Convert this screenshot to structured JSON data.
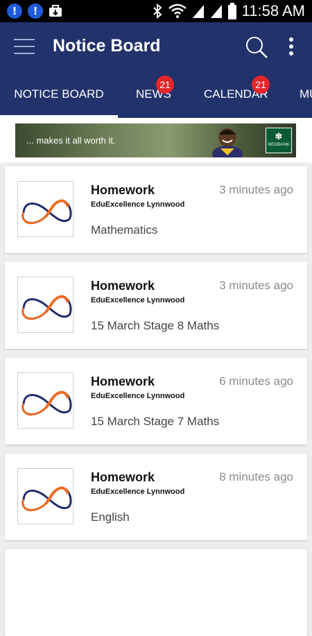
{
  "status_bar": {
    "time": "11:58 AM",
    "left_icons": [
      "alert-icon",
      "alert-icon",
      "briefcase-download-icon"
    ],
    "right_icons": [
      "bluetooth-icon",
      "wifi-icon",
      "signal-icon",
      "signal-icon",
      "battery-icon"
    ]
  },
  "app_bar": {
    "title": "Notice Board"
  },
  "tabs": [
    {
      "label": "NOTICE BOARD",
      "badge": ""
    },
    {
      "label": "NEWS",
      "badge": "21"
    },
    {
      "label": "CALENDAR",
      "badge": "21"
    },
    {
      "label": "MU",
      "badge": ""
    }
  ],
  "banner": {
    "text": "... makes it all worth it.",
    "brand": "NEDBANK"
  },
  "colors": {
    "app_bar": "#22326b",
    "badge": "#e5262a",
    "logo_navy": "#1f2d6b",
    "logo_orange": "#f06a21"
  },
  "notices": [
    {
      "title": "Homework",
      "school": "EduExcellence Lynnwood",
      "time": "3 minutes ago",
      "body": "Mathematics"
    },
    {
      "title": "Homework",
      "school": "EduExcellence Lynnwood",
      "time": "3 minutes ago",
      "body": "15 March Stage 8 Maths"
    },
    {
      "title": "Homework",
      "school": "EduExcellence Lynnwood",
      "time": "6 minutes ago",
      "body": "15 March Stage 7 Maths"
    },
    {
      "title": "Homework",
      "school": "EduExcellence Lynnwood",
      "time": "8 minutes ago",
      "body": "English"
    }
  ]
}
